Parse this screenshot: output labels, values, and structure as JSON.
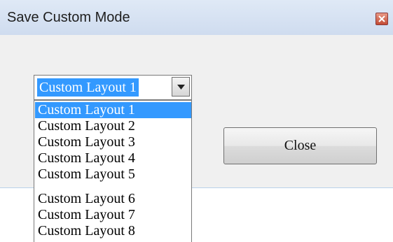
{
  "window": {
    "title": "Save Custom Mode",
    "close_icon": "close-x-icon"
  },
  "combo": {
    "selected": "Custom Layout 1",
    "arrow_icon": "chevron-down-icon"
  },
  "dropdown": {
    "options": [
      "Custom Layout 1",
      "Custom Layout 2",
      "Custom Layout 3",
      "Custom Layout 4",
      "Custom Layout 5",
      "Custom Layout 6",
      "Custom Layout 7",
      "Custom Layout 8"
    ],
    "highlighted": "Custom Layout 1"
  },
  "buttons": {
    "close_label": "Close"
  },
  "colors": {
    "selection": "#3399ff",
    "dialog_bg": "#f0f0f0",
    "titlebar": "#dfe9f6"
  }
}
